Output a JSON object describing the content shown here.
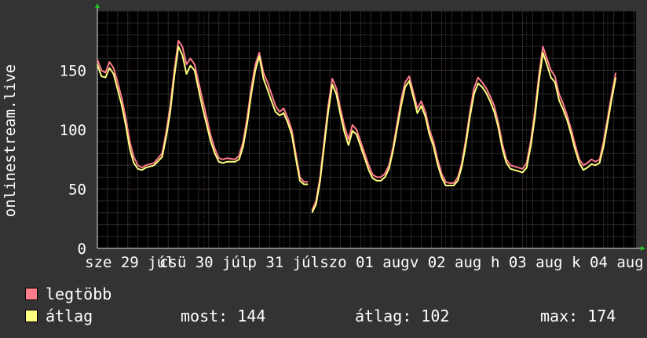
{
  "chart_data": {
    "type": "line",
    "ylabel": "onlinestream.live",
    "ylim": [
      0,
      200
    ],
    "yticks": [
      0,
      50,
      100,
      150
    ],
    "xlim": [
      0,
      6.65
    ],
    "x_tick_labels": [
      "sze 29 júl",
      "csü 30 júl",
      "p 31 júl",
      "szo 01 aug",
      "v 02 aug",
      "h 03 aug",
      "k 04 aug"
    ],
    "x_tick_positions": [
      0.4,
      1.32,
      2.3,
      3.3,
      4.3,
      5.3,
      6.3
    ],
    "grid": true,
    "series": [
      {
        "name": "legtöbb",
        "color": "#ff7c8b",
        "points": [
          [
            0.0,
            159
          ],
          [
            0.05,
            150
          ],
          [
            0.1,
            148
          ],
          [
            0.15,
            157
          ],
          [
            0.2,
            152
          ],
          [
            0.25,
            140
          ],
          [
            0.3,
            127
          ],
          [
            0.35,
            110
          ],
          [
            0.4,
            90
          ],
          [
            0.45,
            77
          ],
          [
            0.5,
            70
          ],
          [
            0.55,
            68
          ],
          [
            0.6,
            70
          ],
          [
            0.7,
            72
          ],
          [
            0.8,
            80
          ],
          [
            0.85,
            98
          ],
          [
            0.9,
            120
          ],
          [
            0.95,
            150
          ],
          [
            1.0,
            175
          ],
          [
            1.05,
            170
          ],
          [
            1.1,
            155
          ],
          [
            1.15,
            160
          ],
          [
            1.2,
            155
          ],
          [
            1.25,
            140
          ],
          [
            1.3,
            125
          ],
          [
            1.35,
            110
          ],
          [
            1.4,
            95
          ],
          [
            1.45,
            84
          ],
          [
            1.5,
            76
          ],
          [
            1.55,
            75
          ],
          [
            1.6,
            76
          ],
          [
            1.7,
            75
          ],
          [
            1.75,
            78
          ],
          [
            1.8,
            90
          ],
          [
            1.85,
            110
          ],
          [
            1.9,
            135
          ],
          [
            1.95,
            155
          ],
          [
            2.0,
            165
          ],
          [
            2.05,
            148
          ],
          [
            2.1,
            140
          ],
          [
            2.15,
            130
          ],
          [
            2.2,
            120
          ],
          [
            2.25,
            115
          ],
          [
            2.3,
            118
          ],
          [
            2.35,
            110
          ],
          [
            2.4,
            100
          ],
          [
            2.45,
            80
          ],
          [
            2.5,
            60
          ],
          [
            2.55,
            56
          ],
          [
            2.6,
            56
          ]
        ]
      },
      {
        "name": "legtöbb-2",
        "color": "#ff7c8b",
        "points": [
          [
            2.65,
            32
          ],
          [
            2.7,
            40
          ],
          [
            2.75,
            60
          ],
          [
            2.8,
            90
          ],
          [
            2.85,
            120
          ],
          [
            2.9,
            143
          ],
          [
            2.95,
            135
          ],
          [
            3.0,
            118
          ],
          [
            3.05,
            103
          ],
          [
            3.1,
            92
          ],
          [
            3.15,
            104
          ],
          [
            3.2,
            100
          ],
          [
            3.25,
            90
          ],
          [
            3.3,
            80
          ],
          [
            3.35,
            70
          ],
          [
            3.4,
            62
          ],
          [
            3.45,
            60
          ],
          [
            3.5,
            60
          ],
          [
            3.55,
            63
          ],
          [
            3.6,
            70
          ],
          [
            3.65,
            85
          ],
          [
            3.7,
            105
          ],
          [
            3.75,
            125
          ],
          [
            3.8,
            140
          ],
          [
            3.85,
            145
          ],
          [
            3.9,
            132
          ],
          [
            3.95,
            118
          ],
          [
            4.0,
            124
          ],
          [
            4.05,
            115
          ],
          [
            4.1,
            100
          ],
          [
            4.15,
            90
          ],
          [
            4.2,
            75
          ],
          [
            4.25,
            63
          ],
          [
            4.3,
            56
          ],
          [
            4.35,
            55
          ],
          [
            4.4,
            55
          ],
          [
            4.45,
            60
          ],
          [
            4.5,
            72
          ],
          [
            4.55,
            92
          ],
          [
            4.6,
            115
          ],
          [
            4.65,
            135
          ],
          [
            4.7,
            144
          ],
          [
            4.75,
            140
          ],
          [
            4.8,
            135
          ],
          [
            4.85,
            128
          ],
          [
            4.9,
            120
          ],
          [
            4.95,
            106
          ],
          [
            5.0,
            88
          ],
          [
            5.05,
            75
          ],
          [
            5.1,
            70
          ],
          [
            5.15,
            69
          ],
          [
            5.2,
            68
          ],
          [
            5.25,
            67
          ],
          [
            5.3,
            72
          ],
          [
            5.35,
            90
          ],
          [
            5.4,
            115
          ],
          [
            5.45,
            145
          ],
          [
            5.5,
            170
          ],
          [
            5.55,
            160
          ],
          [
            5.6,
            150
          ],
          [
            5.65,
            145
          ],
          [
            5.7,
            130
          ],
          [
            5.75,
            122
          ],
          [
            5.8,
            112
          ],
          [
            5.85,
            100
          ],
          [
            5.9,
            87
          ],
          [
            5.95,
            75
          ],
          [
            6.0,
            70
          ],
          [
            6.05,
            72
          ],
          [
            6.1,
            75
          ],
          [
            6.15,
            73
          ],
          [
            6.2,
            75
          ],
          [
            6.25,
            90
          ],
          [
            6.3,
            110
          ],
          [
            6.35,
            130
          ],
          [
            6.4,
            148
          ]
        ]
      },
      {
        "name": "átlag",
        "color": "#ffff80",
        "points": [
          [
            0.0,
            155
          ],
          [
            0.05,
            145
          ],
          [
            0.1,
            144
          ],
          [
            0.15,
            152
          ],
          [
            0.2,
            147
          ],
          [
            0.25,
            134
          ],
          [
            0.3,
            121
          ],
          [
            0.35,
            104
          ],
          [
            0.4,
            84
          ],
          [
            0.45,
            72
          ],
          [
            0.5,
            67
          ],
          [
            0.55,
            66
          ],
          [
            0.6,
            68
          ],
          [
            0.7,
            70
          ],
          [
            0.8,
            77
          ],
          [
            0.85,
            94
          ],
          [
            0.9,
            115
          ],
          [
            0.95,
            145
          ],
          [
            1.0,
            170
          ],
          [
            1.05,
            163
          ],
          [
            1.1,
            147
          ],
          [
            1.15,
            154
          ],
          [
            1.2,
            150
          ],
          [
            1.25,
            134
          ],
          [
            1.3,
            118
          ],
          [
            1.35,
            104
          ],
          [
            1.4,
            90
          ],
          [
            1.45,
            80
          ],
          [
            1.5,
            73
          ],
          [
            1.55,
            72
          ],
          [
            1.6,
            73
          ],
          [
            1.7,
            73
          ],
          [
            1.75,
            75
          ],
          [
            1.8,
            86
          ],
          [
            1.85,
            105
          ],
          [
            1.9,
            130
          ],
          [
            1.95,
            150
          ],
          [
            2.0,
            162
          ],
          [
            2.05,
            143
          ],
          [
            2.1,
            134
          ],
          [
            2.15,
            124
          ],
          [
            2.2,
            115
          ],
          [
            2.25,
            112
          ],
          [
            2.3,
            114
          ],
          [
            2.35,
            106
          ],
          [
            2.4,
            96
          ],
          [
            2.45,
            76
          ],
          [
            2.5,
            57
          ],
          [
            2.55,
            54
          ],
          [
            2.6,
            54
          ]
        ]
      },
      {
        "name": "átlag-2",
        "color": "#ffff80",
        "points": [
          [
            2.65,
            30
          ],
          [
            2.7,
            37
          ],
          [
            2.75,
            57
          ],
          [
            2.8,
            86
          ],
          [
            2.85,
            115
          ],
          [
            2.9,
            138
          ],
          [
            2.95,
            130
          ],
          [
            3.0,
            113
          ],
          [
            3.05,
            98
          ],
          [
            3.1,
            87
          ],
          [
            3.15,
            99
          ],
          [
            3.2,
            96
          ],
          [
            3.25,
            86
          ],
          [
            3.3,
            76
          ],
          [
            3.35,
            66
          ],
          [
            3.4,
            59
          ],
          [
            3.45,
            57
          ],
          [
            3.5,
            57
          ],
          [
            3.55,
            60
          ],
          [
            3.6,
            67
          ],
          [
            3.65,
            82
          ],
          [
            3.7,
            101
          ],
          [
            3.75,
            120
          ],
          [
            3.8,
            136
          ],
          [
            3.85,
            141
          ],
          [
            3.9,
            128
          ],
          [
            3.95,
            114
          ],
          [
            4.0,
            120
          ],
          [
            4.05,
            111
          ],
          [
            4.1,
            96
          ],
          [
            4.15,
            86
          ],
          [
            4.2,
            71
          ],
          [
            4.25,
            60
          ],
          [
            4.3,
            53
          ],
          [
            4.35,
            53
          ],
          [
            4.4,
            53
          ],
          [
            4.45,
            57
          ],
          [
            4.5,
            69
          ],
          [
            4.55,
            88
          ],
          [
            4.6,
            111
          ],
          [
            4.65,
            130
          ],
          [
            4.7,
            139
          ],
          [
            4.75,
            136
          ],
          [
            4.8,
            131
          ],
          [
            4.85,
            124
          ],
          [
            4.9,
            115
          ],
          [
            4.95,
            102
          ],
          [
            5.0,
            84
          ],
          [
            5.05,
            72
          ],
          [
            5.1,
            67
          ],
          [
            5.15,
            66
          ],
          [
            5.2,
            65
          ],
          [
            5.25,
            64
          ],
          [
            5.3,
            68
          ],
          [
            5.35,
            86
          ],
          [
            5.4,
            110
          ],
          [
            5.45,
            140
          ],
          [
            5.5,
            165
          ],
          [
            5.55,
            155
          ],
          [
            5.6,
            144
          ],
          [
            5.65,
            140
          ],
          [
            5.7,
            125
          ],
          [
            5.75,
            117
          ],
          [
            5.8,
            108
          ],
          [
            5.85,
            96
          ],
          [
            5.9,
            83
          ],
          [
            5.95,
            72
          ],
          [
            6.0,
            66
          ],
          [
            6.05,
            68
          ],
          [
            6.1,
            71
          ],
          [
            6.15,
            70
          ],
          [
            6.2,
            72
          ],
          [
            6.25,
            86
          ],
          [
            6.3,
            106
          ],
          [
            6.35,
            126
          ],
          [
            6.4,
            144
          ]
        ]
      }
    ]
  },
  "legend": [
    {
      "label": "legtöbb",
      "color": "#ff7c8b"
    },
    {
      "label": "átlag",
      "color": "#ffff80"
    }
  ],
  "stats": {
    "now": "most: 144",
    "avg": "átlag: 102",
    "max": "max: 174"
  }
}
